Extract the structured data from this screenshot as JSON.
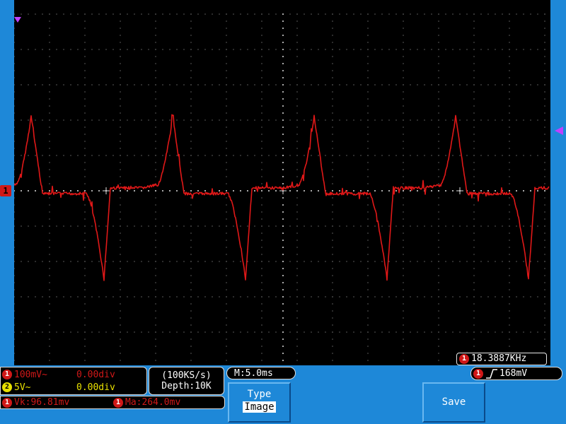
{
  "screen": {
    "channel_marker": "1",
    "frequency": "18.3887KHz"
  },
  "waveform": {
    "color": "#e01818",
    "period_divs": 4.0,
    "peak_divs": 2.3,
    "trough_divs": -2.5
  },
  "status": {
    "ch1_scale": "100mV~",
    "ch1_offset": "0.00div",
    "ch2_scale": "5V~",
    "ch2_offset": "0.00div",
    "sample_rate": "(100KS/s)",
    "depth": "Depth:10K",
    "time_base": "M:5.0ms",
    "trigger_level": "168mV",
    "meas_vk": "Vk:96.81mv",
    "meas_ma": "Ma:264.0mv"
  },
  "buttons": {
    "type_label": "Type",
    "type_value": "Image",
    "save_label": "Save"
  },
  "colors": {
    "ch1": "#d01818",
    "ch2": "#e8e000",
    "panel": "#1e88d8"
  }
}
